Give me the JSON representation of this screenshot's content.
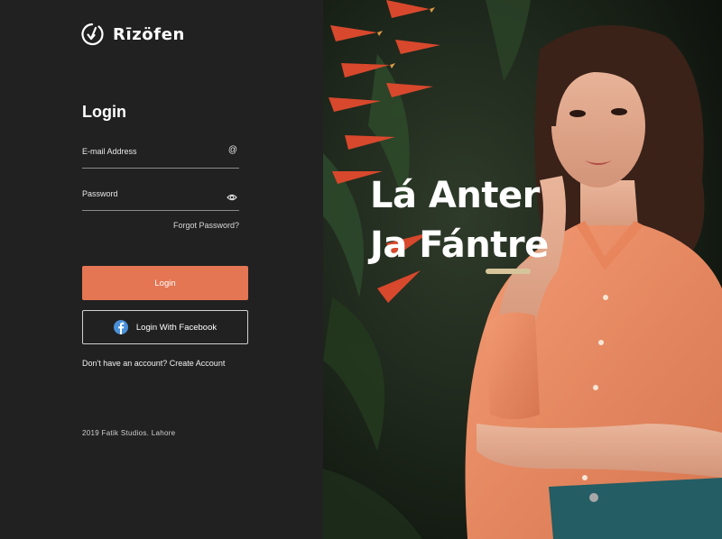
{
  "brand": {
    "name": "Rīzöfen"
  },
  "login": {
    "title": "Login",
    "email_label": "E-mail Address",
    "password_label": "Password",
    "forgot_password": "Forgot Password?",
    "login_button": "Login",
    "facebook_button": "Login With Facebook",
    "signup_text": "Don't have an account? Create Account"
  },
  "footer": {
    "text": "2019 Fatik Studios. Lahore"
  },
  "hero": {
    "line1": "Lá Anter",
    "line2": "Ja Fántre"
  },
  "colors": {
    "accent": "#e47653",
    "panel": "#212121",
    "facebook": "#4a90d9"
  }
}
